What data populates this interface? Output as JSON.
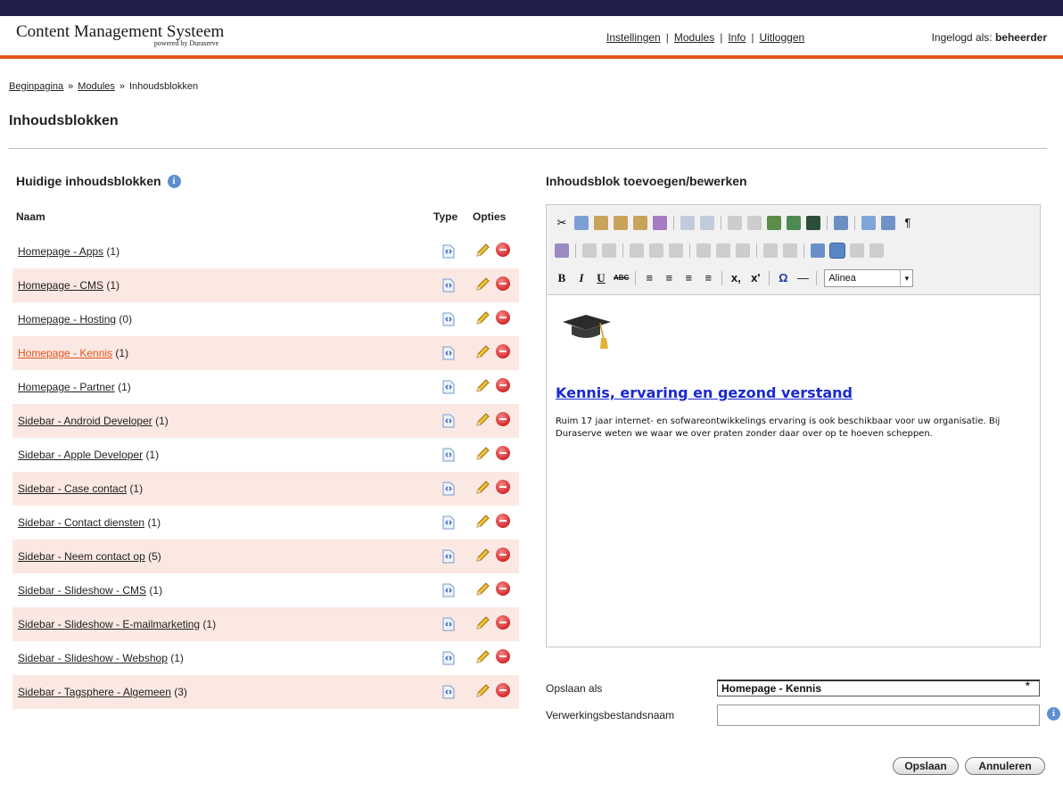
{
  "app": {
    "title": "Content Management Systeem",
    "subtitle": "powered by Duraserve"
  },
  "topnav": {
    "items": [
      {
        "label": "Instellingen"
      },
      {
        "label": "Modules"
      },
      {
        "label": "Info"
      },
      {
        "label": "Uitloggen"
      }
    ],
    "separator": "|"
  },
  "user": {
    "prefix": "Ingelogd als:",
    "name": "beheerder"
  },
  "breadcrumb": {
    "items": [
      "Beginpagina",
      "Modules",
      "Inhoudsblokken"
    ],
    "separator": "»"
  },
  "page": {
    "title": "Inhoudsblokken"
  },
  "left_panel": {
    "title": "Huidige inhoudsblokken",
    "info_icon": "i",
    "columns": {
      "name": "Naam",
      "type": "Type",
      "options": "Opties"
    },
    "rows": [
      {
        "name": "Homepage - Apps",
        "count": "(1)",
        "active": false
      },
      {
        "name": "Homepage - CMS",
        "count": "(1)",
        "active": false
      },
      {
        "name": "Homepage - Hosting",
        "count": "(0)",
        "active": false
      },
      {
        "name": "Homepage - Kennis",
        "count": "(1)",
        "active": true
      },
      {
        "name": "Homepage - Partner",
        "count": "(1)",
        "active": false
      },
      {
        "name": "Sidebar - Android Developer",
        "count": "(1)",
        "active": false
      },
      {
        "name": "Sidebar - Apple Developer",
        "count": "(1)",
        "active": false
      },
      {
        "name": "Sidebar - Case contact",
        "count": "(1)",
        "active": false
      },
      {
        "name": "Sidebar - Contact diensten",
        "count": "(1)",
        "active": false
      },
      {
        "name": "Sidebar - Neem contact op",
        "count": "(5)",
        "active": false
      },
      {
        "name": "Sidebar - Slideshow - CMS",
        "count": "(1)",
        "active": false
      },
      {
        "name": "Sidebar - Slideshow - E-mailmarketing",
        "count": "(1)",
        "active": false
      },
      {
        "name": "Sidebar - Slideshow - Webshop",
        "count": "(1)",
        "active": false
      },
      {
        "name": "Sidebar - Tagsphere - Algemeen",
        "count": "(3)",
        "active": false
      }
    ]
  },
  "right_panel": {
    "title": "Inhoudsblok toevoegen/bewerken",
    "toolbar": {
      "format_bold": "B",
      "format_italic": "I",
      "format_underline": "U",
      "strike": "ABC",
      "subscript": "x,",
      "superscript": "x'",
      "omega": "Ω",
      "hr": "—",
      "pilcrow": "¶",
      "format_select": "Alinea"
    },
    "content": {
      "heading": "Kennis, ervaring en gezond verstand",
      "body": "Ruim 17 jaar internet- en sofwareontwikkelings ervaring is ook beschikbaar voor uw organisatie. Bij Duraserve weten we waar we over praten zonder daar over op te hoeven scheppen."
    },
    "form": {
      "save_as_label": "Opslaan als",
      "save_as_value": "Homepage - Kennis",
      "required_mark": "*",
      "file_label": "Verwerkingsbestandsnaam",
      "file_value": ""
    },
    "buttons": {
      "save": "Opslaan",
      "cancel": "Annuleren"
    }
  },
  "colors": {
    "topbar": "#221f4a",
    "accent": "#e4531c",
    "row_alt": "#fbe8e2",
    "link_heading": "#1a29d0"
  }
}
